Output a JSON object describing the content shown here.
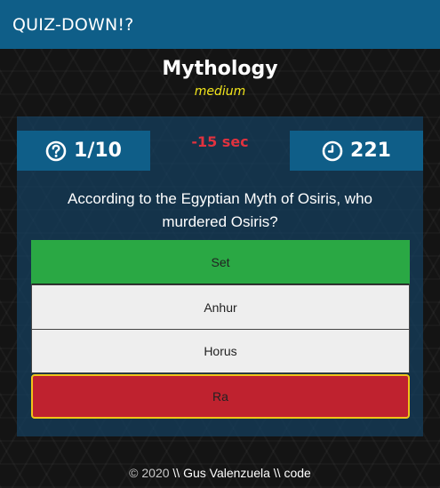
{
  "app": {
    "brand": "QUIZ-DOWN!?"
  },
  "quiz": {
    "category": "Mythology",
    "difficulty": "medium",
    "progress_label": "1/10",
    "penalty_text": "-15 sec",
    "timer_label": "221",
    "question": "According to the Egyptian Myth of Osiris, who murdered Osiris?",
    "answers": [
      {
        "label": "Set",
        "state": "correct"
      },
      {
        "label": "Anhur",
        "state": "neutral"
      },
      {
        "label": "Horus",
        "state": "neutral"
      },
      {
        "label": "Ra",
        "state": "wrong-selected"
      }
    ]
  },
  "footer": {
    "copyright": "© 2020",
    "credit": "\\\\ Gus Valenzuela \\\\ code"
  },
  "icons": {
    "progress": "question-circle-icon",
    "timer": "clock-icon"
  },
  "colors": {
    "navbar": "#0f5e88",
    "difficulty": "#f2e51b",
    "penalty": "#e0323f",
    "correct": "#2aa844",
    "wrong": "#bf222f",
    "wrong_border": "#f0c419"
  }
}
